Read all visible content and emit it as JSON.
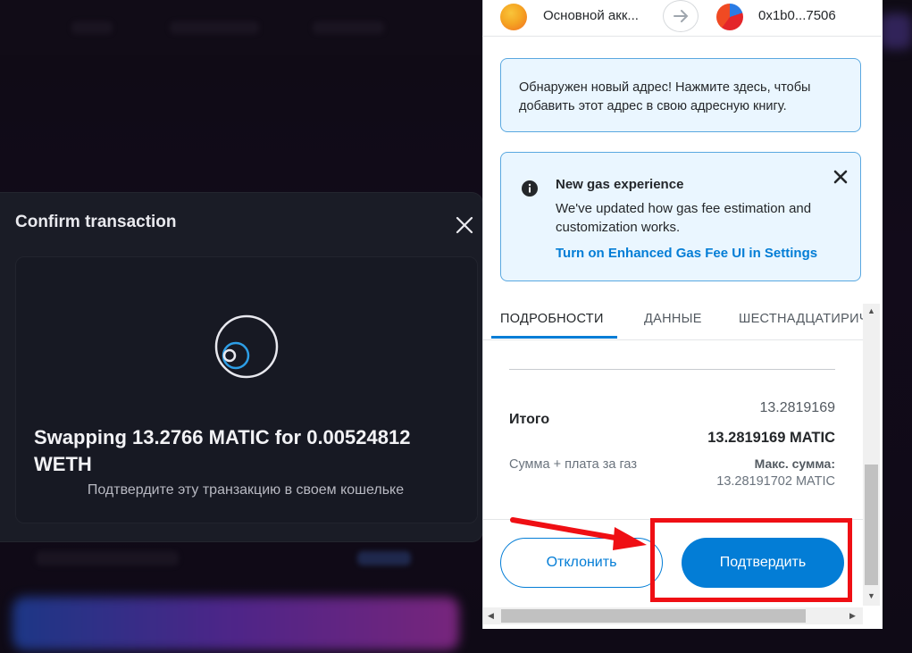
{
  "app": {
    "modal": {
      "title": "Confirm transaction",
      "swap_text": "Swapping 13.2766 MATIC for 0.00524812 WETH",
      "subtitle": "Подтвердите эту транзакцию в своем кошельке"
    }
  },
  "wallet": {
    "account": {
      "from_name": "Основной акк...",
      "to_address": "0x1b0...7506"
    },
    "notice_text": "Обнаружен новый адрес! Нажмите здесь, чтобы добавить этот адрес в свою адресную книгу.",
    "gas_notice": {
      "title": "New gas experience",
      "body": "We've updated how gas fee estimation and customization works.",
      "link": "Turn on Enhanced Gas Fee UI in Settings"
    },
    "tabs": [
      {
        "label": "ПОДРОБНОСТИ",
        "active": true
      },
      {
        "label": "ДАННЫЕ",
        "active": false
      },
      {
        "label": "ШЕСТНАДЦАТИРИЧНЫЕ",
        "active": false
      }
    ],
    "summary": {
      "total_label": "Итого",
      "total_value": "13.2819169",
      "total_value_bold": "13.2819169 MATIC",
      "sum_label": "Сумма + плата за газ",
      "max_label": "Макс. сумма:",
      "max_value": "13.28191702 MATIC"
    },
    "buttons": {
      "reject": "Отклонить",
      "confirm": "Подтвердить"
    }
  },
  "colors": {
    "accent": "#037dd6",
    "highlight": "#ef0f14",
    "modal_bg": "#1a1c26"
  }
}
